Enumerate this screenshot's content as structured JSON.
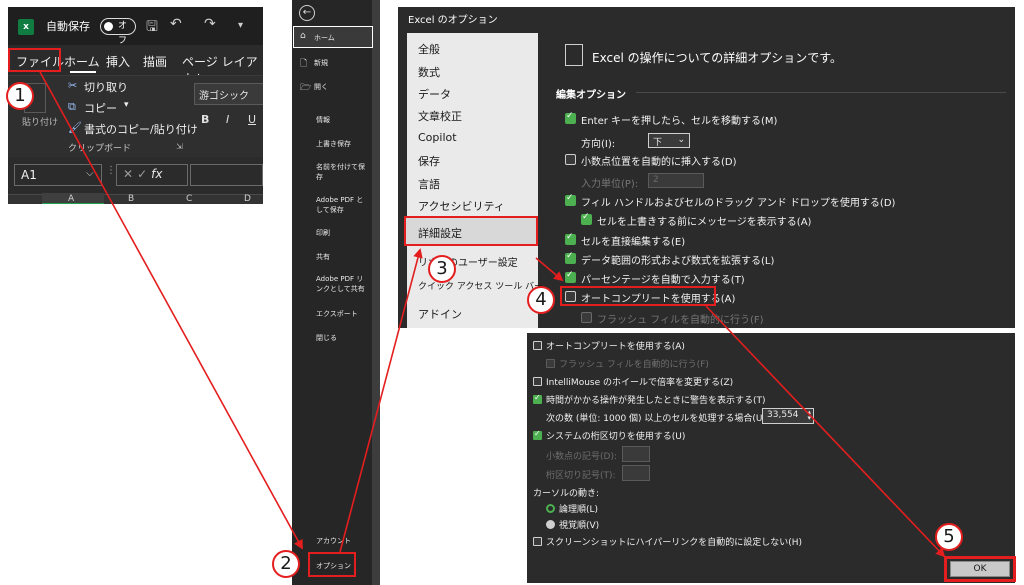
{
  "ribbon": {
    "autosave_label": "自動保存",
    "toggle_state": "オフ",
    "tabs": [
      "ファイル",
      "ホーム",
      "挿入",
      "描画",
      "ページ レイアウト"
    ],
    "paste_label": "貼り付け",
    "cut": "切り取り",
    "copy": "コピー",
    "copy_format": "書式のコピー/貼り付け",
    "group_label": "クリップボード",
    "font_name": "游ゴシック",
    "bold": "B",
    "italic": "I",
    "underline": "U",
    "name_box": "A1",
    "fx": "fx",
    "columns": [
      "A",
      "B",
      "C",
      "D"
    ]
  },
  "backstage": {
    "home": "ホーム",
    "new": "新規",
    "open": "開く",
    "info": "情報",
    "save": "上書き保存",
    "save_as": "名前を付けて保存",
    "adobe_pdf_save": "Adobe PDF として保存",
    "print": "印刷",
    "share": "共有",
    "adobe_pdf_share": "Adobe PDF リンクとして共有",
    "export": "エクスポート",
    "close": "閉じる",
    "account": "アカウント",
    "options": "オプション"
  },
  "dialog": {
    "title": "Excel のオプション",
    "nav": [
      "全般",
      "数式",
      "データ",
      "文章校正",
      "Copilot",
      "保存",
      "言語",
      "アクセシビリティ",
      "詳細設定",
      "リボンのユーザー設定",
      "クイック アクセス ツール バー",
      "アドイン"
    ],
    "heading": "Excel の操作についての詳細オプションです。",
    "section": "編集オプション",
    "enter_move": "Enter キーを押したら、セルを移動する(M)",
    "direction_label": "方向(I):",
    "direction_value": "下",
    "auto_decimal": "小数点位置を自動的に挿入する(D)",
    "input_unit_label": "入力単位(P):",
    "input_unit_value": "2",
    "fill_handle": "フィル ハンドルおよびセルのドラッグ アンド ドロップを使用する(D)",
    "overwrite_msg": "セルを上書きする前にメッセージを表示する(A)",
    "direct_edit": "セルを直接編集する(E)",
    "extend_format": "データ範囲の形式および数式を拡張する(L)",
    "auto_percent": "パーセンテージを自動で入力する(T)",
    "autocomplete": "オートコンプリートを使用する(A)",
    "flash_fill": "フラッシュ フィルを自動的に行う(F)"
  },
  "dialog2": {
    "autocomplete": "オートコンプリートを使用する(A)",
    "flash_fill": "フラッシュ フィルを自動的に行う(F)",
    "intellimouse": "IntelliMouse のホイールで倍率を変更する(Z)",
    "slow_warning": "時間がかかる操作が発生したときに警告を表示する(T)",
    "cells_label": "次の数 (単位: 1000 個) 以上のセルを処理する場合(U):",
    "cells_value": "33,554",
    "system_separator": "システムの桁区切りを使用する(U)",
    "decimal_sep": "小数点の記号(D):",
    "thousands_sep": "桁区切り記号(T):",
    "cursor_label": "カーソルの動き:",
    "logical": "論理順(L)",
    "visual": "視覚順(V)",
    "screenshot_link": "スクリーンショットにハイパーリンクを自動的に設定しない(H)",
    "ok": "OK"
  },
  "steps": [
    "1",
    "2",
    "3",
    "4",
    "5"
  ],
  "colors": {
    "accent_red": "#e41e1e",
    "check_green": "#4caf50",
    "excel_green": "#107c41"
  }
}
